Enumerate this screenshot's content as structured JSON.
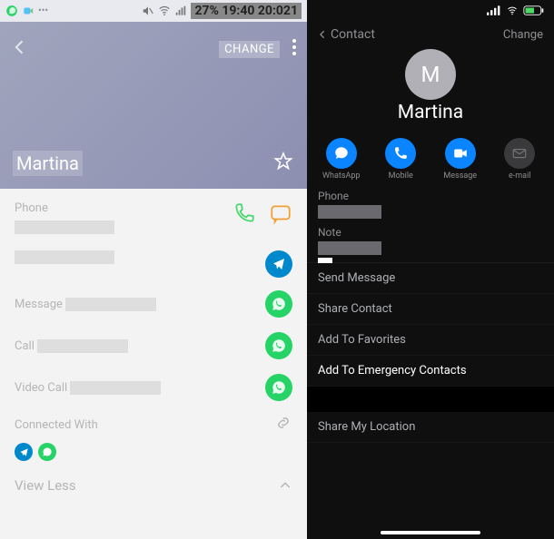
{
  "left": {
    "statusbar": {
      "battery_time": "27% 19:40 20:021"
    },
    "header": {
      "change": "CHANGE",
      "name": "Martina"
    },
    "phone": {
      "label": "Phone"
    },
    "message": {
      "label": "Message"
    },
    "call": {
      "label": "Call"
    },
    "videocall": {
      "label": "Video Call"
    },
    "connected": {
      "label": "Connected With"
    },
    "viewless": "View Less"
  },
  "right": {
    "statusbar": {
      "time": ""
    },
    "header": {
      "back": "Contact",
      "change": "Change"
    },
    "avatar_letter": "M",
    "name": "Martina",
    "actions": {
      "a1": "WhatsApp",
      "a2": "Mobile",
      "a3": "Message",
      "a4": "e-mail"
    },
    "phone": {
      "label": "Phone"
    },
    "note": {
      "label": "Note"
    },
    "items": {
      "send": "Send Message",
      "share": "Share Contact",
      "fav": "Add To Favorites",
      "emerg": "Add To Emergency Contacts",
      "loc": "Share My Location"
    }
  }
}
